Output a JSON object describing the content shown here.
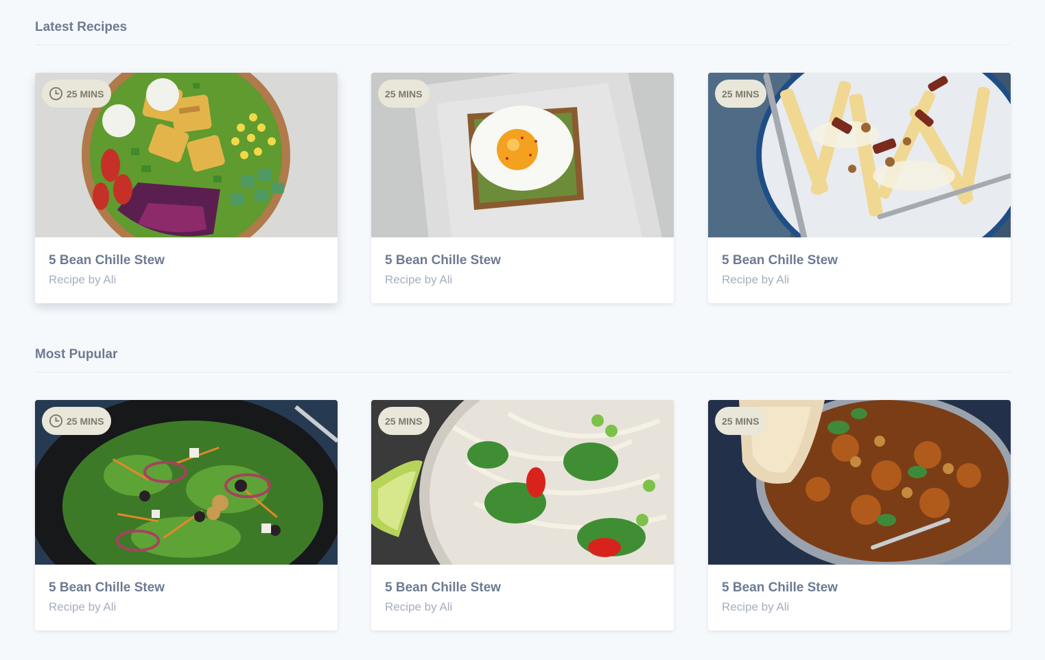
{
  "sections": [
    {
      "title": "Latest Recipes",
      "cards": [
        {
          "time": "25 MINS",
          "title": "5 Bean Chille Stew",
          "author": "Recipe by Ali"
        },
        {
          "time": "25 MINS",
          "title": "5 Bean Chille Stew",
          "author": "Recipe by Ali"
        },
        {
          "time": "25 MINS",
          "title": "5 Bean Chille Stew",
          "author": "Recipe by Ali"
        }
      ]
    },
    {
      "title": "Most Pupular",
      "cards": [
        {
          "time": "25 MINS",
          "title": "5 Bean Chille Stew",
          "author": "Recipe by Ali"
        },
        {
          "time": "25 MINS",
          "title": "5 Bean Chille Stew",
          "author": "Recipe by Ali"
        },
        {
          "time": "25 MINS",
          "title": "5 Bean Chille Stew",
          "author": "Recipe by Ali"
        }
      ]
    }
  ],
  "icons": {
    "time_badge": "clock-icon"
  },
  "colors": {
    "background": "#f6f9fc",
    "heading": "#6c7a92",
    "muted": "#a4aebe",
    "badge": "#e9e7d9"
  }
}
